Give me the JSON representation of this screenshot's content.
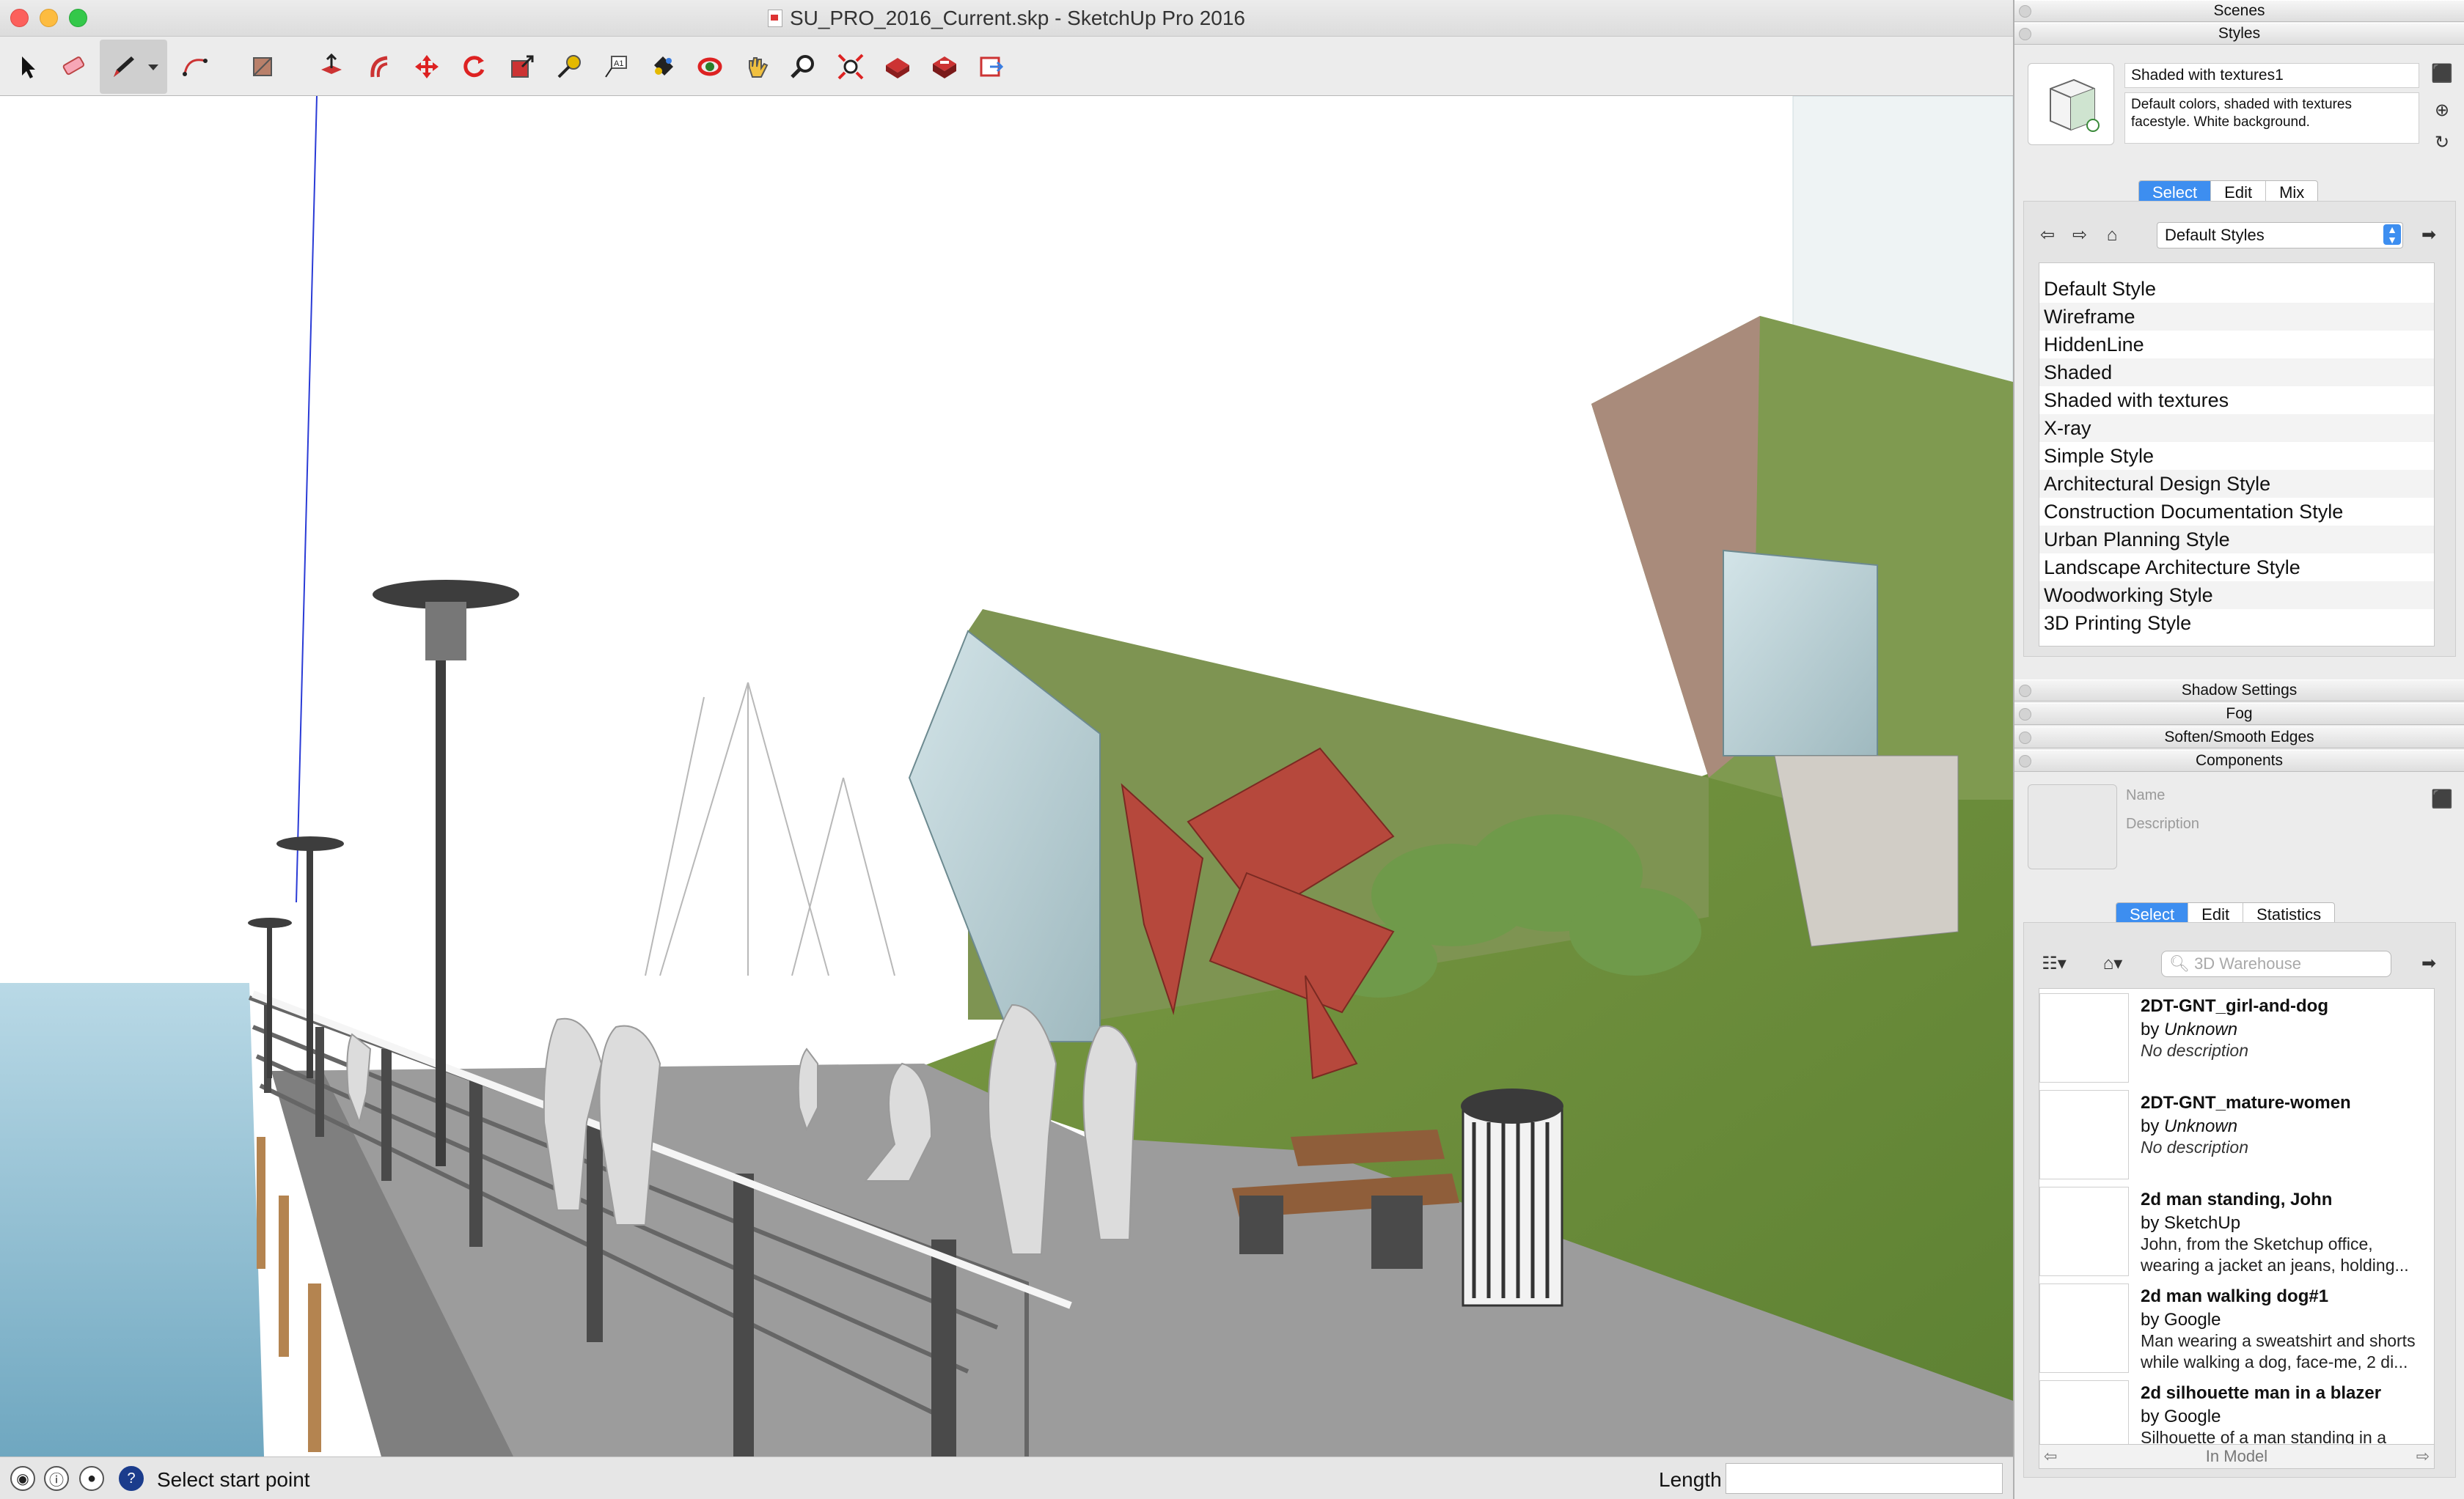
{
  "window": {
    "title": "SU_PRO_2016_Current.skp - SketchUp Pro 2016"
  },
  "toolbar": {
    "tools": [
      "select-tool",
      "eraser-tool",
      "line-tool",
      "arc-tool",
      "rectangle-tool",
      "push-pull-tool",
      "offset-tool",
      "move-tool",
      "rotate-tool",
      "scale-tool",
      "tape-measure-tool",
      "text-tool",
      "paint-bucket-tool",
      "orbit-tool",
      "pan-tool",
      "zoom-tool",
      "zoom-extents-tool",
      "warehouse-tool",
      "extension-warehouse-tool",
      "layout-tool"
    ],
    "active_tool": "line-tool"
  },
  "statusbar": {
    "hint": "Select start point",
    "length_label": "Length",
    "length_value": ""
  },
  "tray": {
    "scenes_header": "Scenes",
    "styles_header": "Styles",
    "style_name": "Shaded with textures1",
    "style_description": "Default colors, shaded with textures facestyle. White background.",
    "style_tabs": [
      "Select",
      "Edit",
      "Mix"
    ],
    "style_collection": "Default Styles",
    "style_list": [
      "Default Style",
      "Wireframe",
      "HiddenLine",
      "Shaded",
      "Shaded with textures",
      "X-ray",
      "Simple Style",
      "Architectural Design Style",
      "Construction Documentation Style",
      "Urban Planning Style",
      "Landscape Architecture Style",
      "Woodworking Style",
      "3D Printing Style"
    ],
    "shadow_header": "Shadow Settings",
    "fog_header": "Fog",
    "soften_header": "Soften/Smooth Edges",
    "components_header": "Components",
    "component_name_placeholder": "Name",
    "component_desc_placeholder": "Description",
    "component_tabs": [
      "Select",
      "Edit",
      "Statistics"
    ],
    "search_placeholder": "3D Warehouse",
    "components": [
      {
        "name": "2DT-GNT_girl-and-dog",
        "by_prefix": "by",
        "author": "Unknown",
        "description": "No description",
        "italic_desc": true
      },
      {
        "name": "2DT-GNT_mature-women",
        "by_prefix": "by",
        "author": "Unknown",
        "description": "No description",
        "italic_desc": true
      },
      {
        "name": "2d man standing, John",
        "by_prefix": "by",
        "author": "SketchUp",
        "description": "John, from the Sketchup office, wearing a jacket an jeans, holding...",
        "italic_desc": false
      },
      {
        "name": "2d man walking dog#1",
        "by_prefix": "by",
        "author": "Google",
        "description": "Man wearing a sweatshirt and shorts while walking a dog, face-me, 2 di...",
        "italic_desc": false
      },
      {
        "name": "2d silhouette man in a blazer",
        "by_prefix": "by",
        "author": "Google",
        "description": "Silhouette of a man standing in a",
        "italic_desc": false
      }
    ],
    "in_model_label": "In Model"
  }
}
